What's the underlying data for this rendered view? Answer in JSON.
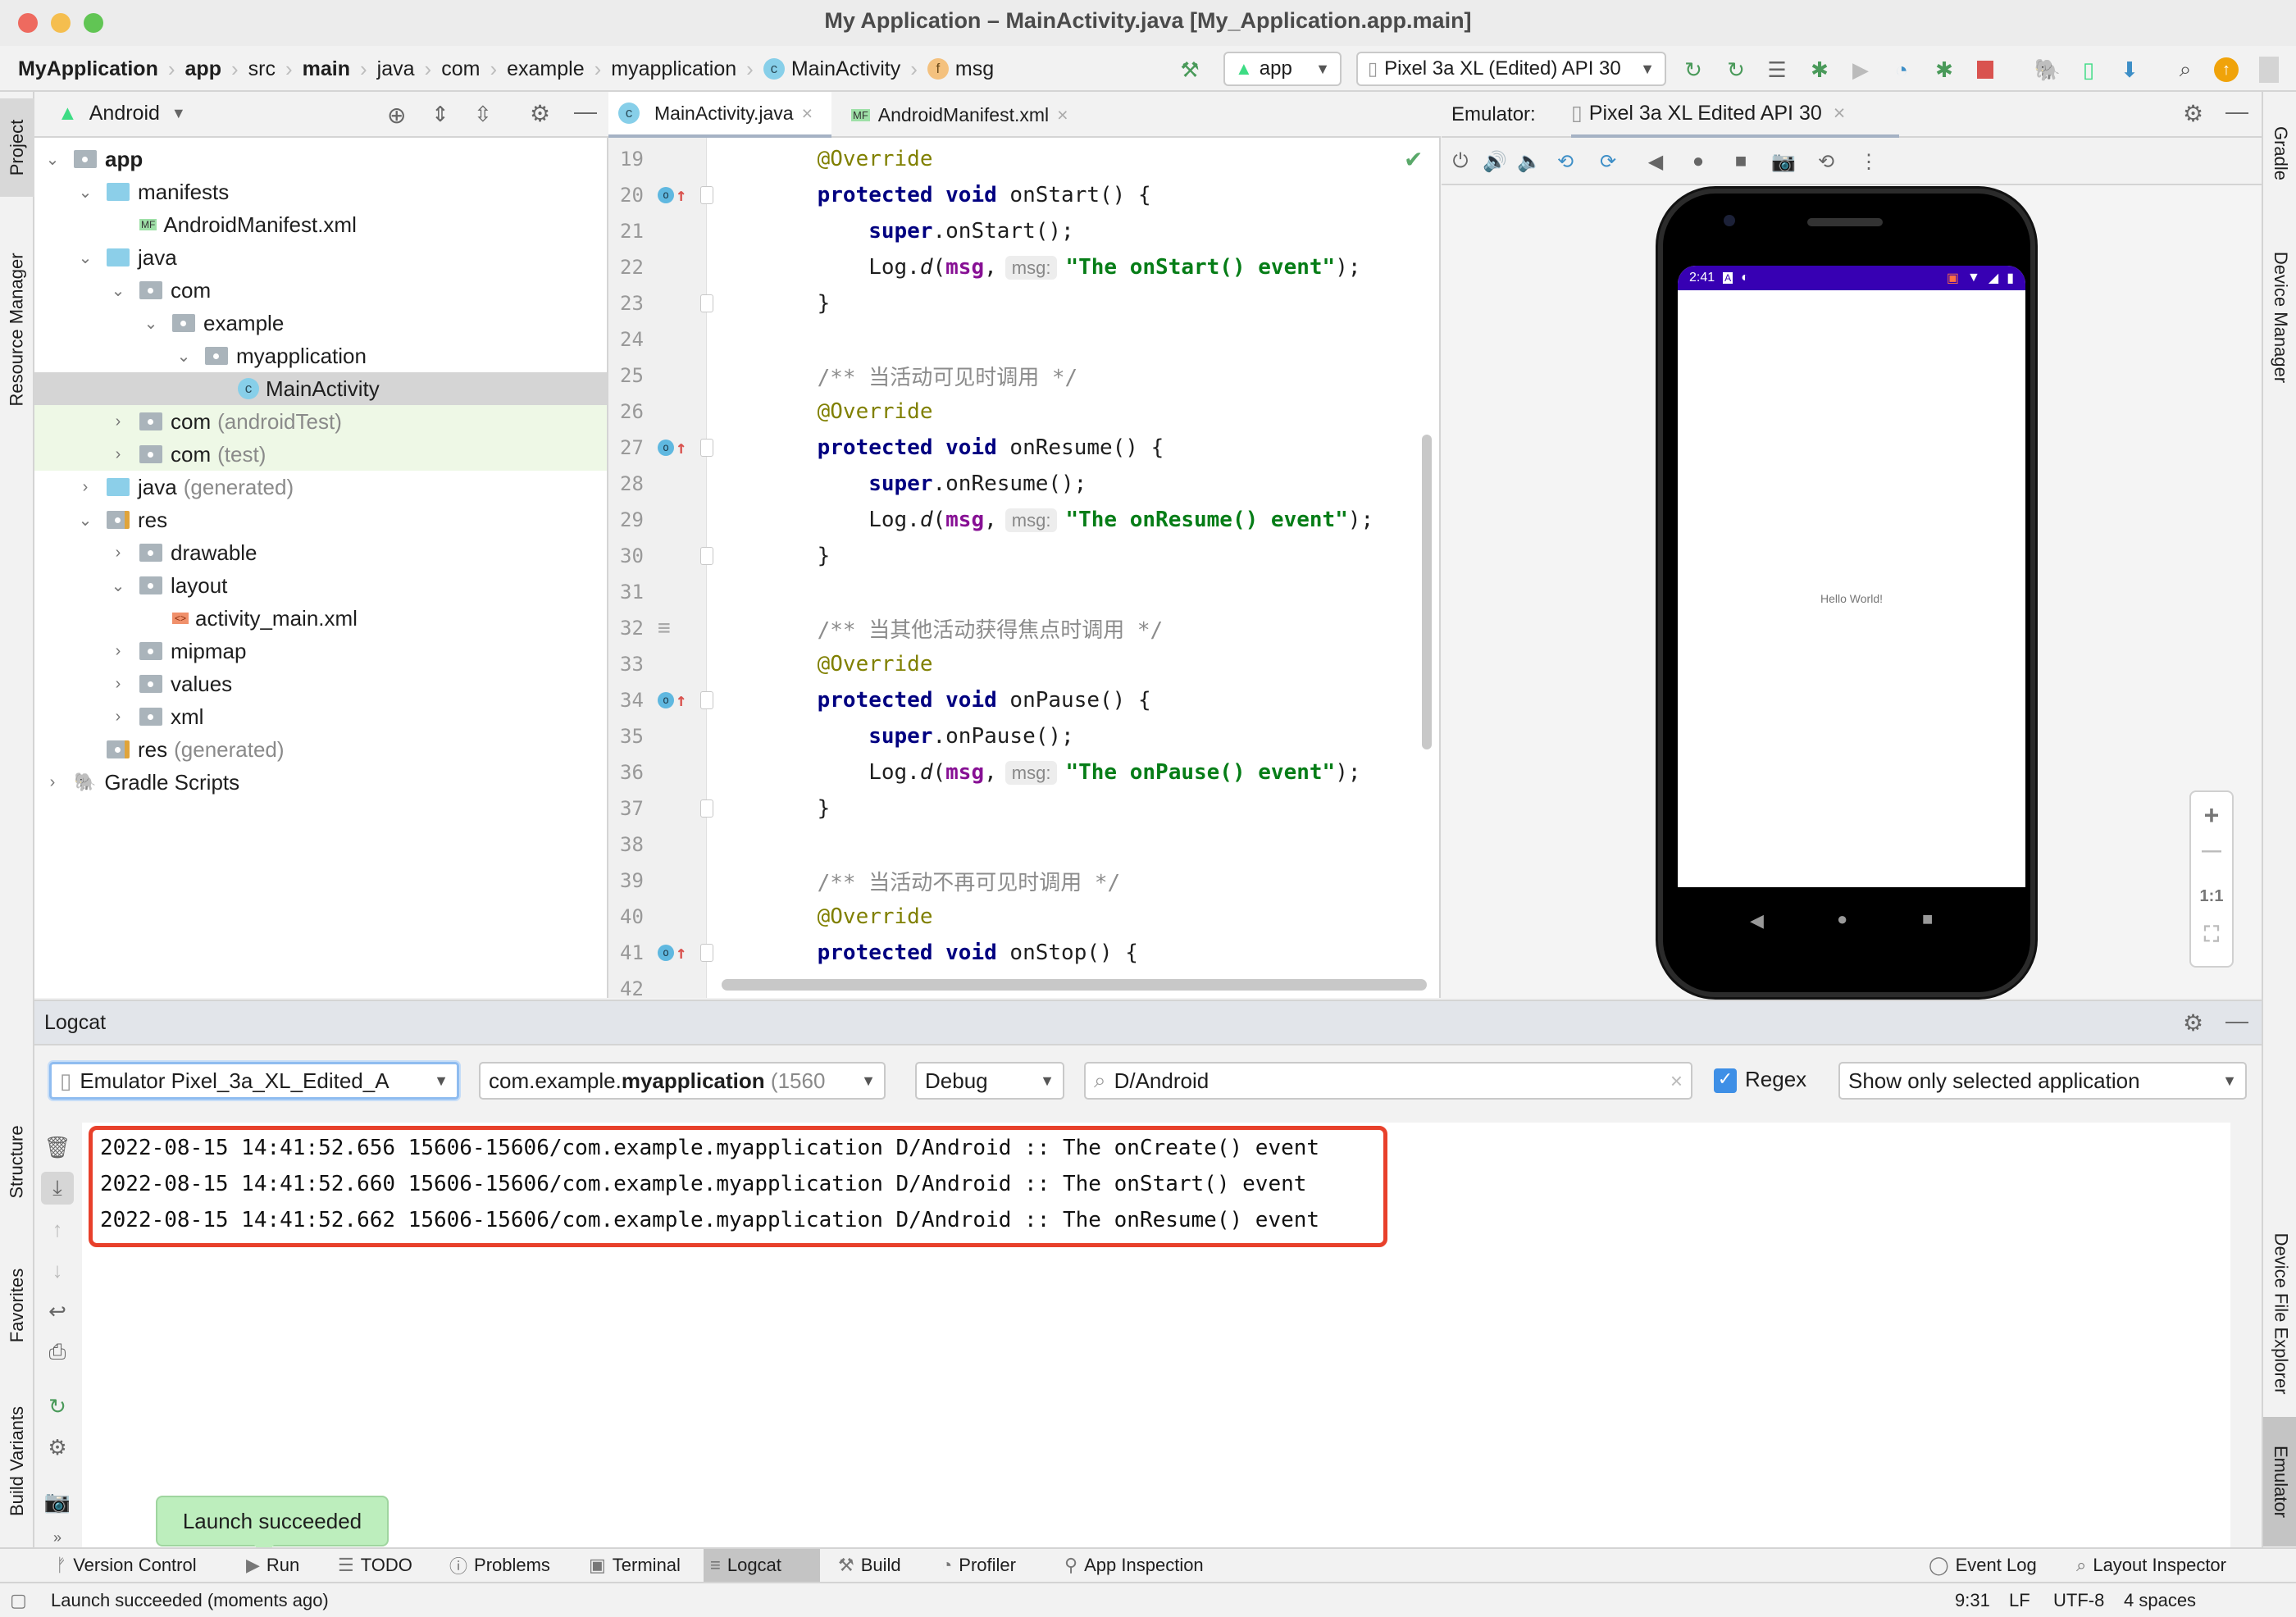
{
  "window": {
    "title": "My Application – MainActivity.java [My_Application.app.main]",
    "traffic_lights": {
      "close": "#ee6a5f",
      "minimize": "#f5be4f",
      "maximize": "#61c554"
    }
  },
  "breadcrumb": [
    {
      "label": "MyApplication",
      "bold": true
    },
    {
      "label": "app",
      "bold": true
    },
    {
      "label": "src"
    },
    {
      "label": "main",
      "bold": true
    },
    {
      "label": "java"
    },
    {
      "label": "com"
    },
    {
      "label": "example"
    },
    {
      "label": "myapplication"
    },
    {
      "label": "MainActivity",
      "icon": "class-icon"
    },
    {
      "label": "msg",
      "icon": "field-icon"
    }
  ],
  "toolbar": {
    "run_config": "app",
    "device": "Pixel 3a XL (Edited) API 30",
    "icons": [
      "build-hammer-icon",
      "apply-changes-restart-icon",
      "apply-code-changes-icon",
      "run-coverage-icon",
      "debug-icon",
      "profile-icon",
      "profiler-icon",
      "attach-debugger-icon",
      "stop-icon",
      "sync-gradle-icon",
      "device-manager-icon",
      "sdk-manager-icon",
      "search-icon",
      "update-icon",
      "account-icon"
    ]
  },
  "left_strip": {
    "tabs": [
      "Project",
      "Resource Manager",
      "Structure",
      "Favorites",
      "Build Variants"
    ]
  },
  "right_strip": {
    "tabs": [
      "Gradle",
      "Device Manager",
      "Device File Explorer",
      "Emulator"
    ]
  },
  "project": {
    "view": "Android",
    "tree": [
      {
        "label": "app",
        "bold": true,
        "depth": 0,
        "expanded": true,
        "icon": "module"
      },
      {
        "label": "manifests",
        "depth": 1,
        "expanded": true,
        "icon": "folder-blue"
      },
      {
        "label": "AndroidManifest.xml",
        "depth": 2,
        "icon": "manifest-file"
      },
      {
        "label": "java",
        "depth": 1,
        "expanded": true,
        "icon": "folder-blue"
      },
      {
        "label": "com",
        "depth": 2,
        "expanded": true,
        "icon": "package"
      },
      {
        "label": "example",
        "depth": 3,
        "expanded": true,
        "icon": "package"
      },
      {
        "label": "myapplication",
        "depth": 4,
        "expanded": true,
        "icon": "package"
      },
      {
        "label": "MainActivity",
        "depth": 5,
        "icon": "class",
        "selected": true
      },
      {
        "label": "com",
        "suffix": "(androidTest)",
        "depth": 2,
        "expanded": false,
        "icon": "package",
        "test": true
      },
      {
        "label": "com",
        "suffix": "(test)",
        "depth": 2,
        "expanded": false,
        "icon": "package",
        "test": true
      },
      {
        "label": "java",
        "suffix": "(generated)",
        "depth": 1,
        "expanded": false,
        "icon": "folder-generated"
      },
      {
        "label": "res",
        "depth": 1,
        "expanded": true,
        "icon": "res-folder"
      },
      {
        "label": "drawable",
        "depth": 2,
        "expanded": false,
        "icon": "package"
      },
      {
        "label": "layout",
        "depth": 2,
        "expanded": true,
        "icon": "package"
      },
      {
        "label": "activity_main.xml",
        "depth": 3,
        "icon": "layout-file"
      },
      {
        "label": "mipmap",
        "depth": 2,
        "expanded": false,
        "icon": "package"
      },
      {
        "label": "values",
        "depth": 2,
        "expanded": false,
        "icon": "package"
      },
      {
        "label": "xml",
        "depth": 2,
        "expanded": false,
        "icon": "package"
      },
      {
        "label": "res",
        "suffix": "(generated)",
        "depth": 1,
        "icon": "res-folder"
      },
      {
        "label": "Gradle Scripts",
        "depth": 0,
        "expanded": false,
        "icon": "gradle"
      }
    ]
  },
  "editor": {
    "tabs": [
      {
        "label": "MainActivity.java",
        "active": true,
        "icon": "class-icon"
      },
      {
        "label": "AndroidManifest.xml",
        "active": false,
        "icon": "manifest-icon"
      }
    ],
    "lines": [
      {
        "n": "19",
        "tokens": [
          [
            "ann",
            "    @Override"
          ]
        ]
      },
      {
        "n": "20",
        "override": true,
        "fold": true,
        "tokens": [
          [
            "kw",
            "    protected void "
          ],
          [
            "",
            "onStart() {"
          ]
        ]
      },
      {
        "n": "21",
        "tokens": [
          [
            "kw",
            "        super"
          ],
          [
            "",
            ".onStart();"
          ]
        ]
      },
      {
        "n": "22",
        "tokens": [
          [
            "",
            "        Log."
          ],
          [
            "it",
            "d"
          ],
          [
            "",
            "("
          ],
          [
            "fld",
            "msg"
          ],
          [
            "",
            ","
          ],
          [
            "hint",
            "msg:"
          ],
          [
            "str",
            "\"The onStart() event\""
          ],
          [
            "",
            ");"
          ]
        ]
      },
      {
        "n": "23",
        "fold": true,
        "tokens": [
          [
            "",
            "    }"
          ]
        ]
      },
      {
        "n": "24",
        "tokens": []
      },
      {
        "n": "25",
        "tokens": [
          [
            "cmt",
            "    /** 当活动可见时调用 */"
          ]
        ]
      },
      {
        "n": "26",
        "tokens": [
          [
            "ann",
            "    @Override"
          ]
        ]
      },
      {
        "n": "27",
        "override": true,
        "fold": true,
        "tokens": [
          [
            "kw",
            "    protected void "
          ],
          [
            "",
            "onResume() {"
          ]
        ]
      },
      {
        "n": "28",
        "tokens": [
          [
            "kw",
            "        super"
          ],
          [
            "",
            ".onResume();"
          ]
        ]
      },
      {
        "n": "29",
        "tokens": [
          [
            "",
            "        Log."
          ],
          [
            "it",
            "d"
          ],
          [
            "",
            "("
          ],
          [
            "fld",
            "msg"
          ],
          [
            "",
            ","
          ],
          [
            "hint",
            "msg:"
          ],
          [
            "str",
            "\"The onResume() event\""
          ],
          [
            "",
            ");"
          ]
        ]
      },
      {
        "n": "30",
        "fold": true,
        "tokens": [
          [
            "",
            "    }"
          ]
        ]
      },
      {
        "n": "31",
        "tokens": []
      },
      {
        "n": "32",
        "doc": true,
        "tokens": [
          [
            "cmt",
            "    /** 当其他活动获得焦点时调用 */"
          ]
        ]
      },
      {
        "n": "33",
        "tokens": [
          [
            "ann",
            "    @Override"
          ]
        ]
      },
      {
        "n": "34",
        "override": true,
        "fold": true,
        "tokens": [
          [
            "kw",
            "    protected void "
          ],
          [
            "",
            "onPause() {"
          ]
        ]
      },
      {
        "n": "35",
        "tokens": [
          [
            "kw",
            "        super"
          ],
          [
            "",
            ".onPause();"
          ]
        ]
      },
      {
        "n": "36",
        "tokens": [
          [
            "",
            "        Log."
          ],
          [
            "it",
            "d"
          ],
          [
            "",
            "("
          ],
          [
            "fld",
            "msg"
          ],
          [
            "",
            ","
          ],
          [
            "hint",
            "msg:"
          ],
          [
            "str",
            "\"The onPause() event\""
          ],
          [
            "",
            ");"
          ]
        ]
      },
      {
        "n": "37",
        "fold": true,
        "tokens": [
          [
            "",
            "    }"
          ]
        ]
      },
      {
        "n": "38",
        "tokens": []
      },
      {
        "n": "39",
        "tokens": [
          [
            "cmt",
            "    /** 当活动不再可见时调用 */"
          ]
        ]
      },
      {
        "n": "40",
        "tokens": [
          [
            "ann",
            "    @Override"
          ]
        ]
      },
      {
        "n": "41",
        "override": true,
        "fold": true,
        "tokens": [
          [
            "kw",
            "    protected void "
          ],
          [
            "",
            "onStop() {"
          ]
        ]
      },
      {
        "n": "42",
        "tokens": []
      }
    ]
  },
  "emulator": {
    "label": "Emulator:",
    "device_tab": "Pixel 3a XL Edited API 30",
    "toolbar_icons": [
      "power-icon",
      "volume-up-icon",
      "volume-down-icon",
      "rotate-left-icon",
      "rotate-right-icon",
      "back-icon",
      "home-icon",
      "overview-icon",
      "screenshot-icon",
      "snapshot-icon",
      "more-icon"
    ],
    "phone": {
      "time": "2:41",
      "status_color": "#3700b3",
      "content_text": "Hello World!"
    },
    "zoom_controls": {
      "plus": "+",
      "minus": "—",
      "one_to_one": "1:1"
    }
  },
  "logcat": {
    "title": "Logcat",
    "device_select": "Emulator Pixel_3a_XL_Edited_A",
    "process_select_prefix": "com.example.",
    "process_select_bold": "myapplication",
    "process_select_pid": "(1560",
    "level_select": "Debug",
    "search_value": "D/Android",
    "regex_label": "Regex",
    "regex_checked": true,
    "filter_select": "Show only selected application",
    "lines": [
      "2022-08-15 14:41:52.656 15606-15606/com.example.myapplication D/Android :: The onCreate() event",
      "2022-08-15 14:41:52.660 15606-15606/com.example.myapplication D/Android :: The onStart() event",
      "2022-08-15 14:41:52.662 15606-15606/com.example.myapplication D/Android :: The onResume() event"
    ],
    "highlight_color": "#e8402b"
  },
  "tool_windows": [
    {
      "label": "Version Control",
      "icon": "vcs-icon"
    },
    {
      "label": "Run",
      "icon": "run-icon"
    },
    {
      "label": "TODO",
      "icon": "todo-icon"
    },
    {
      "label": "Problems",
      "icon": "problems-icon"
    },
    {
      "label": "Terminal",
      "icon": "terminal-icon"
    },
    {
      "label": "Logcat",
      "icon": "logcat-icon",
      "active": true
    },
    {
      "label": "Build",
      "icon": "build-icon"
    },
    {
      "label": "Profiler",
      "icon": "profiler-icon"
    },
    {
      "label": "App Inspection",
      "icon": "app-inspection-icon"
    }
  ],
  "tool_windows_right": [
    {
      "label": "Event Log",
      "icon": "event-log-icon"
    },
    {
      "label": "Layout Inspector",
      "icon": "layout-inspector-icon"
    }
  ],
  "toast": "Launch succeeded",
  "status": {
    "message": "Launch succeeded (moments ago)",
    "position": "9:31",
    "line_sep": "LF",
    "encoding": "UTF-8",
    "indent": "4 spaces"
  }
}
